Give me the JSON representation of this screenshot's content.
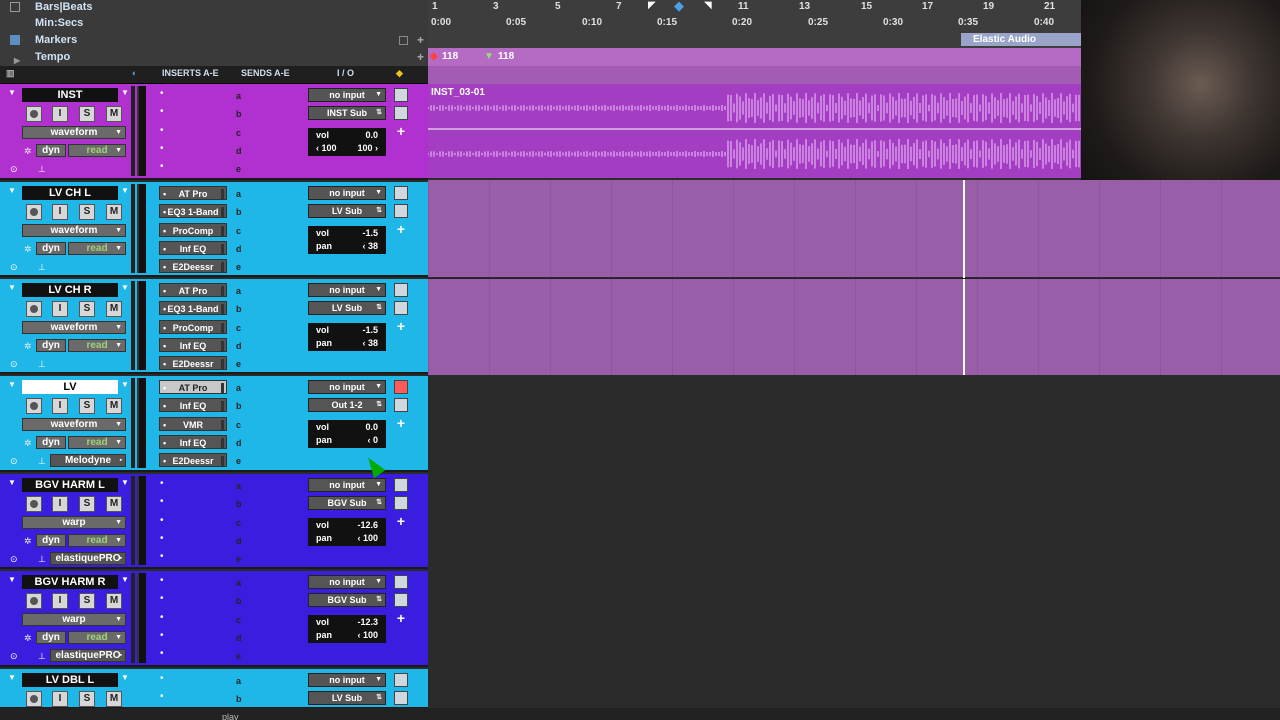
{
  "rulers": {
    "bars_beats": "Bars|Beats",
    "min_secs": "Min:Secs",
    "markers": "Markers",
    "tempo": "Tempo"
  },
  "timeline": {
    "bars": [
      "1",
      "3",
      "5",
      "7",
      "11",
      "13",
      "15",
      "17",
      "19",
      "21"
    ],
    "times": [
      "0:00",
      "0:05",
      "0:10",
      "0:15",
      "0:20",
      "0:25",
      "0:30",
      "0:35",
      "0:40"
    ],
    "marker_label": "Elastic Audio",
    "tempo_values": [
      "118",
      "118"
    ]
  },
  "columns": {
    "inserts": "INSERTS A-E",
    "sends": "SENDS A-E",
    "io": "I / O"
  },
  "buttons": {
    "input": "I",
    "solo": "S",
    "mute": "M"
  },
  "send_letters": [
    "a",
    "b",
    "c",
    "d",
    "e"
  ],
  "labels": {
    "vol": "vol",
    "pan": "pan",
    "play": "play"
  },
  "tracks": [
    {
      "name": "INST",
      "view": "waveform",
      "auto_left": "dyn",
      "auto_right": "read",
      "extra": "",
      "inserts": [],
      "input": "no input",
      "output": "INST Sub",
      "vol": "0.0",
      "pan_l": "100",
      "pan_r": "100",
      "clip": "INST_03-01"
    },
    {
      "name": "LV CH L",
      "view": "waveform",
      "auto_left": "dyn",
      "auto_right": "read",
      "extra": "",
      "inserts": [
        "AT Pro",
        "EQ3 1-Band",
        "ProComp",
        "Inf EQ",
        "E2Deessr"
      ],
      "input": "no input",
      "output": "LV Sub",
      "vol": "-1.5",
      "pan": "38"
    },
    {
      "name": "LV CH R",
      "view": "waveform",
      "auto_left": "dyn",
      "auto_right": "read",
      "extra": "",
      "inserts": [
        "AT Pro",
        "EQ3 1-Band",
        "ProComp",
        "Inf EQ",
        "E2Deessr"
      ],
      "input": "no input",
      "output": "LV Sub",
      "vol": "-1.5",
      "pan": "38"
    },
    {
      "name": "LV",
      "view": "waveform",
      "auto_left": "dyn",
      "auto_right": "read",
      "extra": "Melodyne",
      "inserts": [
        "AT Pro",
        "Inf EQ",
        "VMR",
        "Inf EQ",
        "E2Deessr"
      ],
      "input": "no input",
      "output": "Out 1-2",
      "vol": "0.0",
      "pan": "0"
    },
    {
      "name": "BGV HARM L",
      "view": "warp",
      "auto_left": "dyn",
      "auto_right": "read",
      "extra": "elastiquePRO",
      "inserts": [],
      "input": "no input",
      "output": "BGV Sub",
      "vol": "-12.6",
      "pan": "100"
    },
    {
      "name": "BGV HARM R",
      "view": "warp",
      "auto_left": "dyn",
      "auto_right": "read",
      "extra": "elastiquePRO",
      "inserts": [],
      "input": "no input",
      "output": "BGV Sub",
      "vol": "-12.3",
      "pan": "100"
    },
    {
      "name": "LV DBL L",
      "view": "",
      "auto_left": "",
      "auto_right": "",
      "extra": "",
      "inserts": [],
      "input": "no input",
      "output": "LV Sub",
      "vol": "",
      "pan": ""
    }
  ],
  "colors": {
    "inst": "#b030d0",
    "lv": "#1fb6e8",
    "bgv": "#3a1ee0",
    "clip": "#a33ec2",
    "lane": "#9a5da8"
  }
}
